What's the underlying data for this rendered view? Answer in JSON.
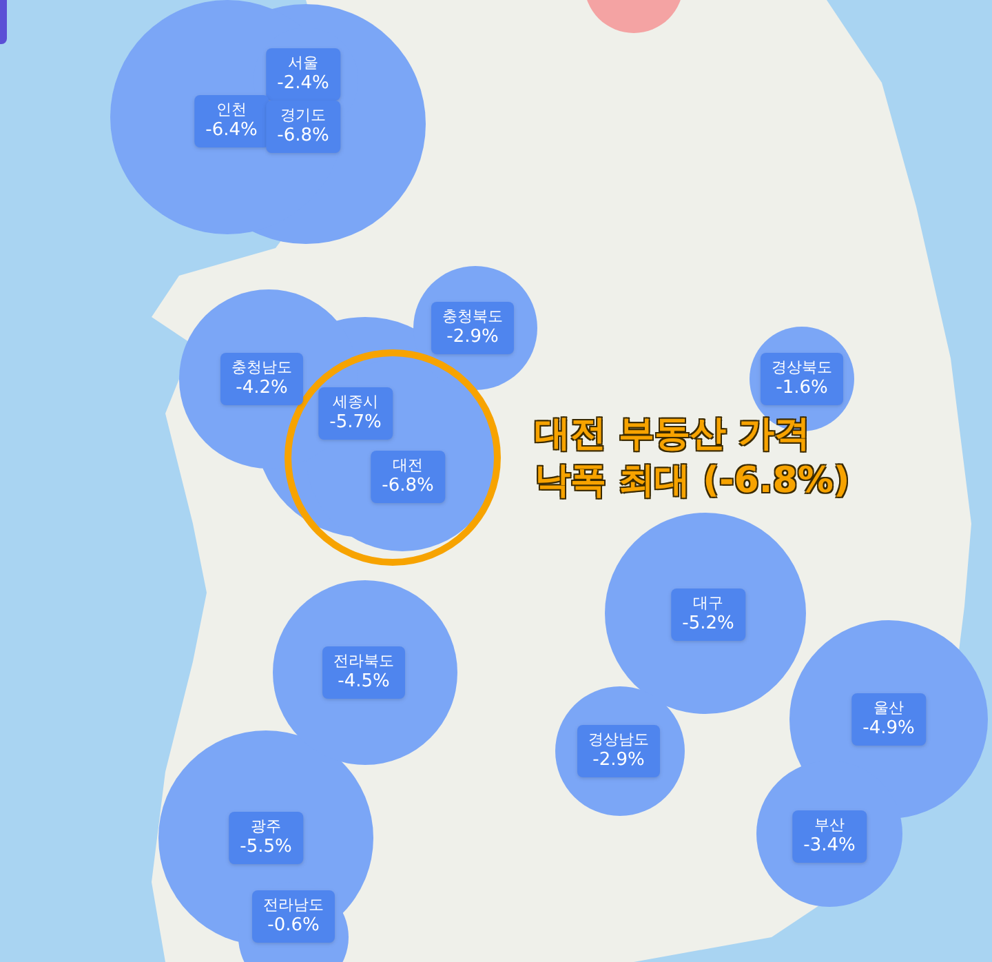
{
  "bubbles": [
    {
      "color": "#f4a3a3"
    },
    {
      "name": "서울",
      "value": "-2.4%",
      "color": "#7ba6f6"
    },
    {
      "name": "인천",
      "value": "-6.4%",
      "color": "#7ba6f6"
    },
    {
      "name": "경기도",
      "value": "-6.8%",
      "color": "#7ba6f6"
    },
    {
      "name": "충청북도",
      "value": "-2.9%",
      "color": "#7ba6f6"
    },
    {
      "name": "충청남도",
      "value": "-4.2%",
      "color": "#7ba6f6"
    },
    {
      "name": "세종시",
      "value": "-5.7%",
      "color": "#7ba6f6"
    },
    {
      "name": "대전",
      "value": "-6.8%",
      "color": "#7ba6f6",
      "highlighted": true
    },
    {
      "name": "경상북도",
      "value": "-1.6%",
      "color": "#7ba6f6"
    },
    {
      "name": "대구",
      "value": "-5.2%",
      "color": "#7ba6f6"
    },
    {
      "name": "전라북도",
      "value": "-4.5%",
      "color": "#7ba6f6"
    },
    {
      "name": "울산",
      "value": "-4.9%",
      "color": "#7ba6f6"
    },
    {
      "name": "경상남도",
      "value": "-2.9%",
      "color": "#7ba6f6"
    },
    {
      "name": "광주",
      "value": "-5.5%",
      "color": "#7ba6f6"
    },
    {
      "name": "부산",
      "value": "-3.4%",
      "color": "#7ba6f6"
    },
    {
      "name": "전라남도",
      "value": "-0.6%",
      "color": "#7ba6f6"
    }
  ],
  "annotation": {
    "lines": [
      "대전 부동산 가격",
      "낙폭 최대 (-6.8%)"
    ]
  }
}
